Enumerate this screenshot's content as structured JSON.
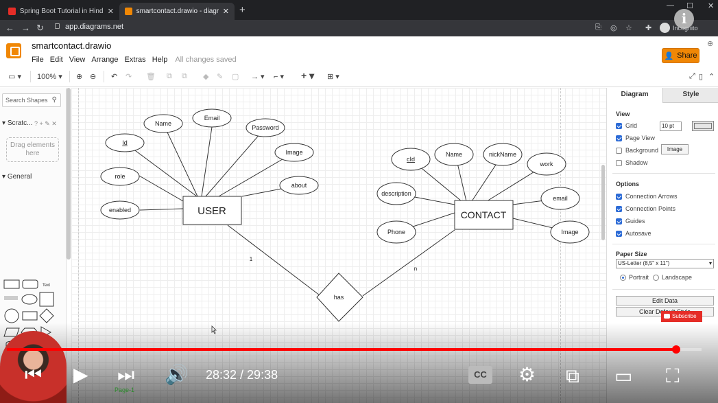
{
  "browser": {
    "tabs": [
      {
        "title": "Spring Boot Tutorial in Hindi - Yo",
        "icon": "youtube-icon",
        "active": false
      },
      {
        "title": "smartcontact.drawio - diagrams.n",
        "icon": "drawio-icon",
        "active": true
      }
    ],
    "url": "app.diagrams.net",
    "profile_name": "Incognito"
  },
  "app": {
    "file_name": "smartcontact.drawio",
    "menus": [
      "File",
      "Edit",
      "View",
      "Arrange",
      "Extras",
      "Help"
    ],
    "save_status": "All changes saved",
    "share_label": "Share",
    "zoom": "100%"
  },
  "sidebar": {
    "search_placeholder": "Search Shapes",
    "scratchpad_label": "Scratc...",
    "scratchpad_icons": "? + ✎ ✕",
    "drop_hint": "Drag elements here",
    "general_label": "General",
    "text_shape_label": "Text"
  },
  "diagram": {
    "user_entity": "USER",
    "user_attributes": [
      "Id",
      "Name",
      "Email",
      "Password",
      "Image",
      "about",
      "role",
      "enabled"
    ],
    "contact_entity": "CONTACT",
    "contact_attributes": [
      "cId",
      "Name",
      "nickName",
      "work",
      "email",
      "Image",
      "description",
      "Phone"
    ],
    "relationship": "has",
    "cardinality_user": "1",
    "cardinality_contact": "n"
  },
  "format_panel": {
    "tab_diagram": "Diagram",
    "tab_style": "Style",
    "view_label": "View",
    "grid_label": "Grid",
    "grid_size": "10 pt",
    "page_view_label": "Page View",
    "background_label": "Background",
    "image_button": "Image",
    "shadow_label": "Shadow",
    "options_label": "Options",
    "connection_arrows": "Connection Arrows",
    "connection_points": "Connection Points",
    "guides": "Guides",
    "autosave": "Autosave",
    "paper_size_label": "Paper Size",
    "paper_size_value": "US-Letter (8,5\" x 11\")",
    "portrait": "Portrait",
    "landscape": "Landscape",
    "edit_data": "Edit Data",
    "clear_default_style": "Clear Default Style",
    "page_tab": "Page-1"
  },
  "video": {
    "time_display": "28:32 / 29:38",
    "progress_fraction": 0.963,
    "subscribe_label": "Subscribe",
    "info_label": "i",
    "cc_label": "CC"
  }
}
